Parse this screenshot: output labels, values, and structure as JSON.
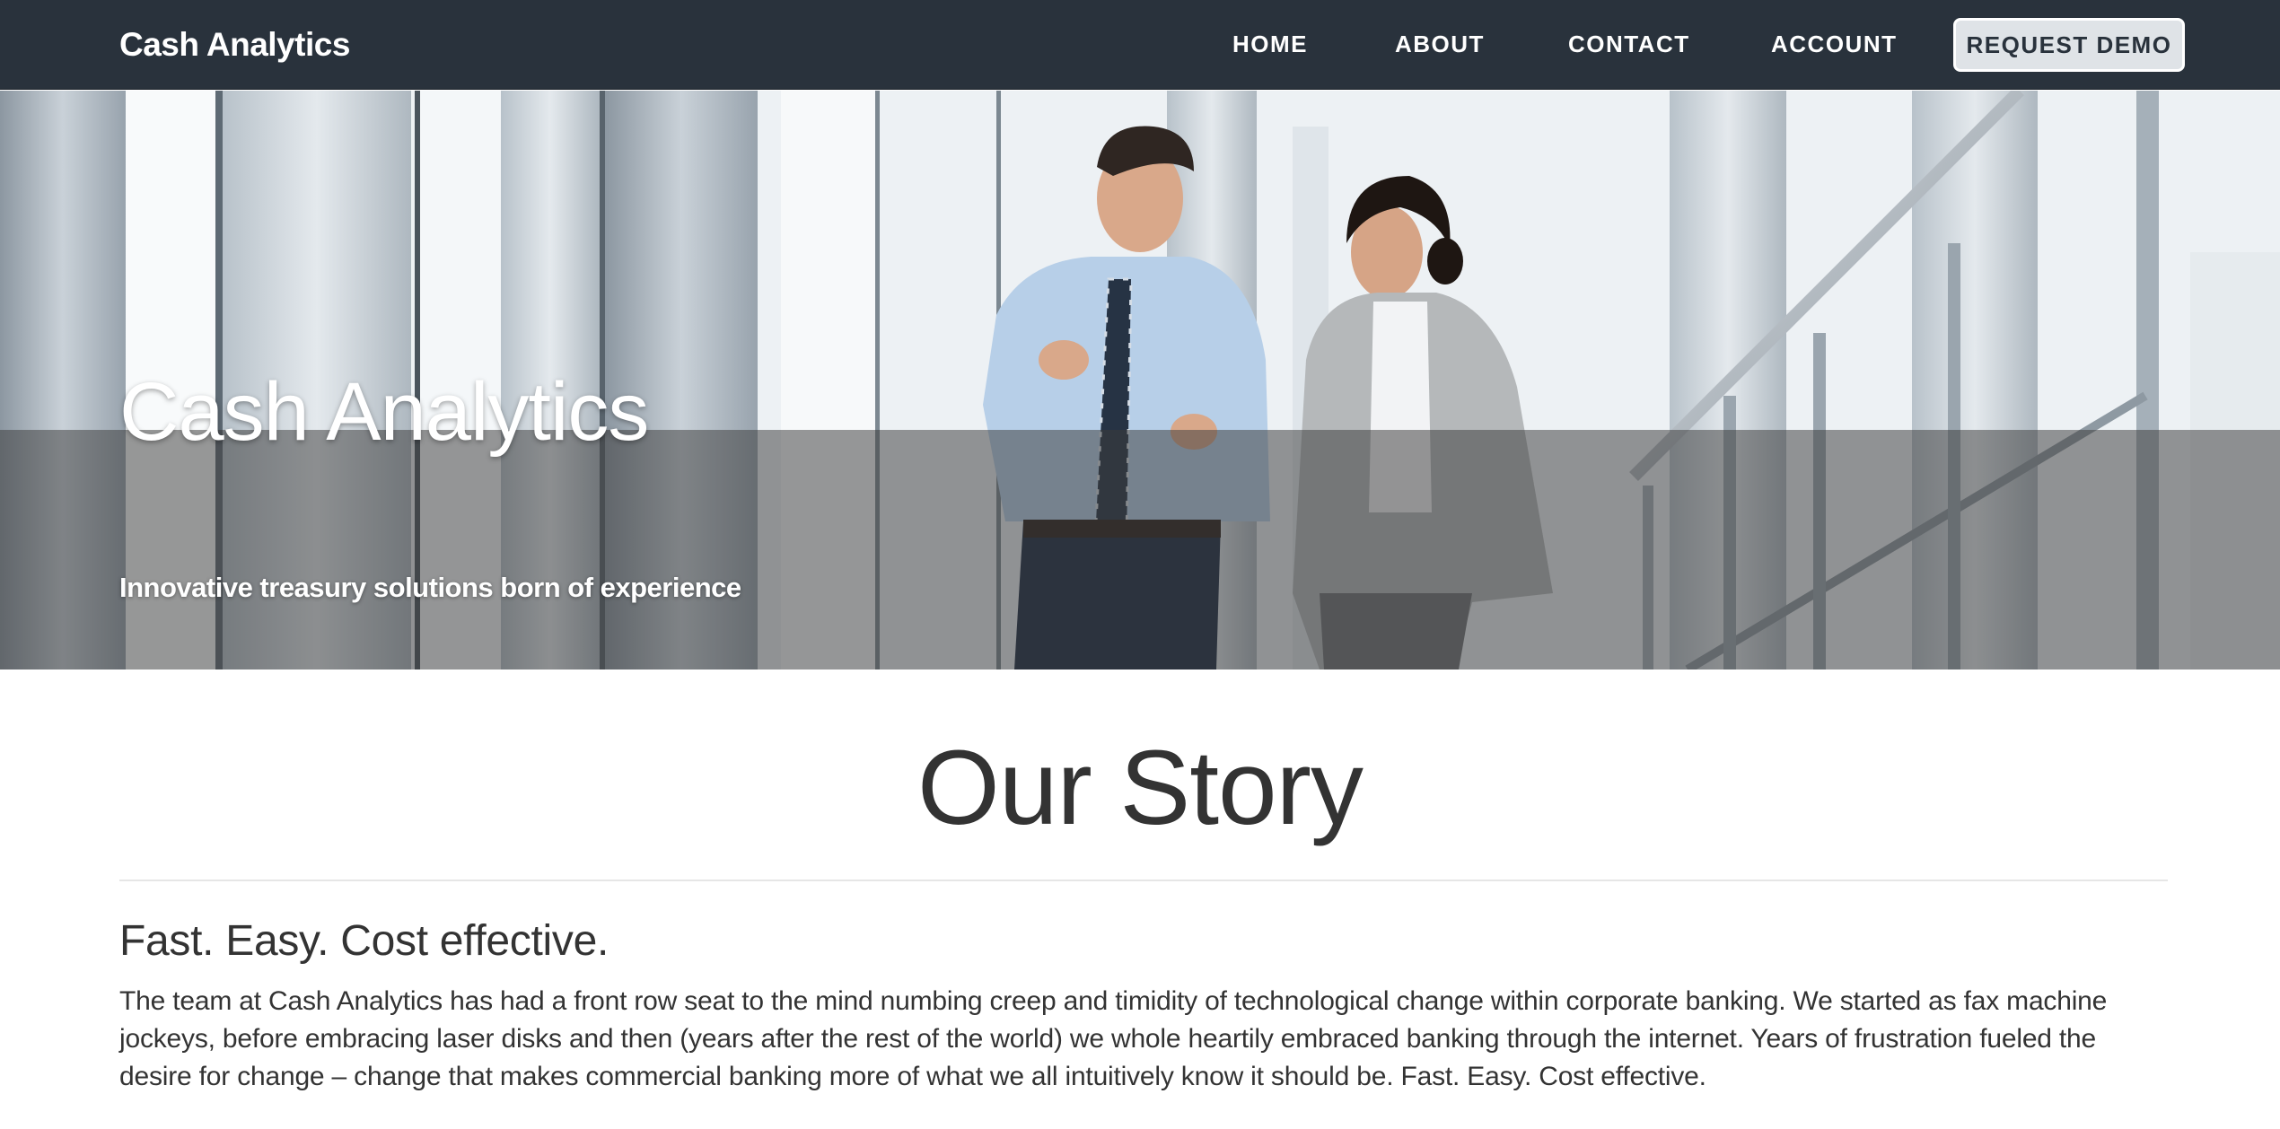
{
  "navbar": {
    "brand": "Cash Analytics",
    "links": [
      {
        "label": "HOME"
      },
      {
        "label": "ABOUT"
      },
      {
        "label": "CONTACT"
      },
      {
        "label": "ACCOUNT"
      }
    ],
    "cta_label": "REQUEST DEMO"
  },
  "hero": {
    "title": "Cash Analytics",
    "subtitle": "Innovative treasury solutions born of experience",
    "image": "two-business-people-walking-photo"
  },
  "content": {
    "title": "Our Story",
    "heading": "Fast. Easy. Cost effective.",
    "body": "The team at Cash Analytics has had a front row seat to the mind numbing creep and timidity of technological change within corporate banking. We started as fax machine jockeys, before embracing laser disks and then (years after the rest of the world) we whole heartily embraced banking through the internet. Years of frustration fueled the desire for change – change that makes commercial banking more of what we all intuitively know it should be. Fast. Easy. Cost effective."
  },
  "colors": {
    "navbar_bg": "#29323c",
    "cta_bg": "#dfe3e7",
    "text": "#333333",
    "overlay": "rgba(60,60,60,0.52)"
  }
}
